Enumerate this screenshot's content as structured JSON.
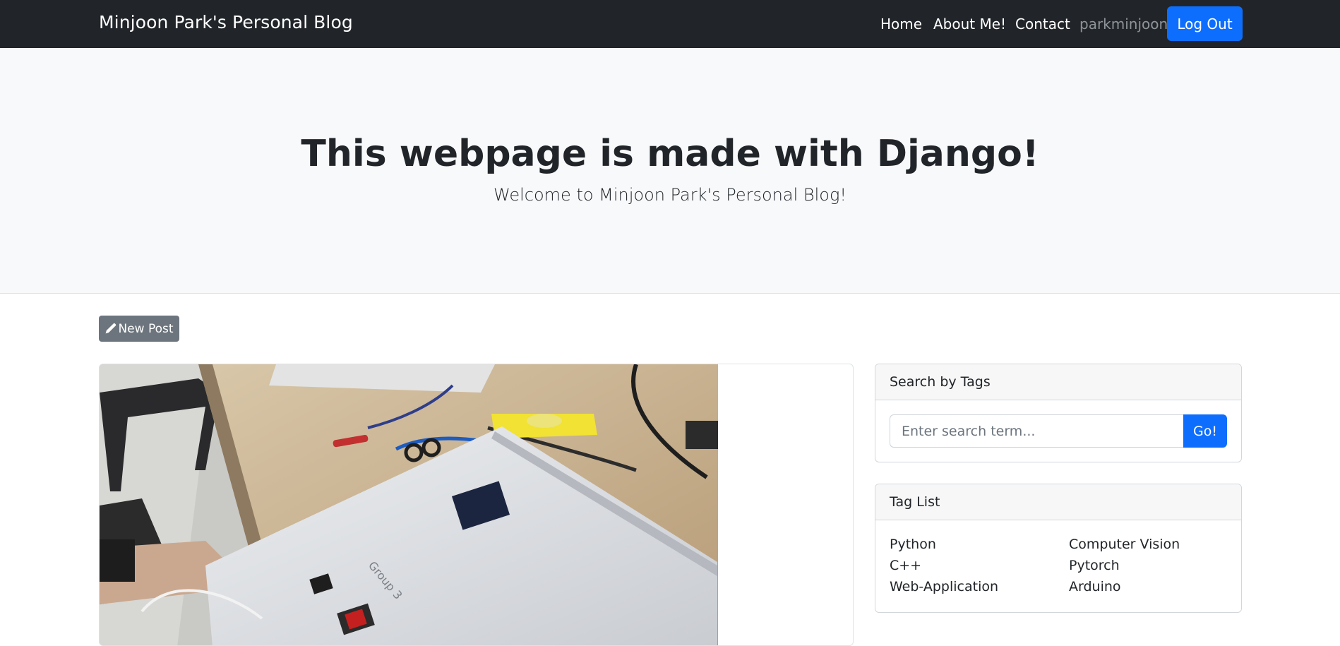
{
  "navbar": {
    "brand": "Minjoon Park's Personal Blog",
    "links": [
      "Home",
      "About Me!",
      "Contact"
    ],
    "username": "parkminjoon",
    "logout_label": "Log Out",
    "bg_color": "#212529"
  },
  "hero": {
    "title": "This webpage is made with Django!",
    "subtitle": "Welcome to Minjoon Park's Personal Blog!"
  },
  "toolbar": {
    "new_post_label": "New Post",
    "new_post_icon": "pencil-icon"
  },
  "sidebar": {
    "search": {
      "header": "Search by Tags",
      "placeholder": "Enter search term...",
      "go_label": "Go!"
    },
    "tags": {
      "header": "Tag List",
      "left": [
        "Python",
        "C++",
        "Web-Application"
      ],
      "right": [
        "Computer Vision",
        "Pytorch",
        "Arduino"
      ]
    }
  },
  "colors": {
    "primary": "#0d6efd",
    "secondary": "#6c757d",
    "hero_bg": "#f8f9fa"
  }
}
